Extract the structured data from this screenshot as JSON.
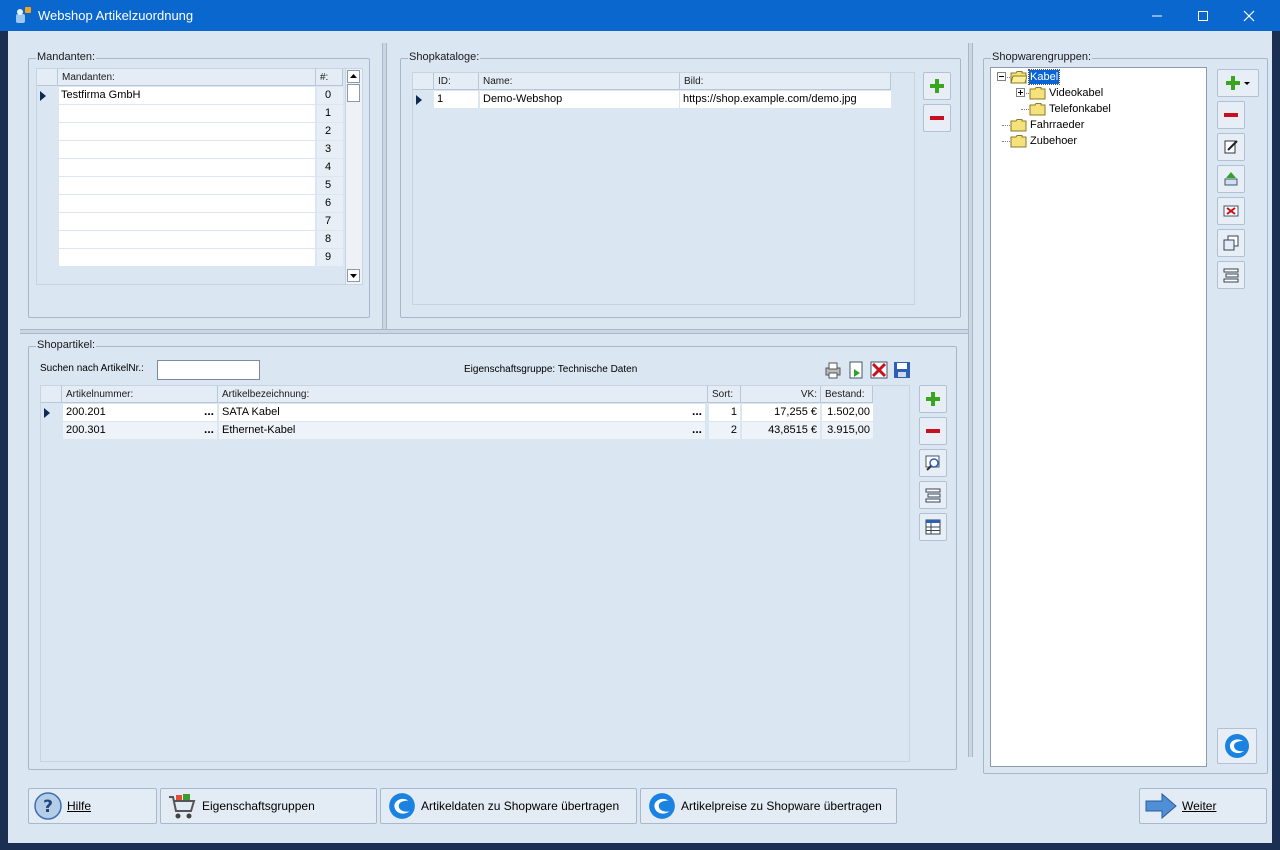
{
  "window": {
    "title": "Webshop Artikelzuordnung"
  },
  "mandanten": {
    "group_title": "Mandanten:",
    "col_name": "Mandanten:",
    "col_num": "#:",
    "rows": [
      {
        "name": "Testfirma GmbH",
        "num": "0"
      },
      {
        "name": "",
        "num": "1"
      },
      {
        "name": "",
        "num": "2"
      },
      {
        "name": "",
        "num": "3"
      },
      {
        "name": "",
        "num": "4"
      },
      {
        "name": "",
        "num": "5"
      },
      {
        "name": "",
        "num": "6"
      },
      {
        "name": "",
        "num": "7"
      },
      {
        "name": "",
        "num": "8"
      },
      {
        "name": "",
        "num": "9"
      }
    ]
  },
  "shopkataloge": {
    "group_title": "Shopkataloge:",
    "col_id": "ID:",
    "col_name": "Name:",
    "col_bild": "Bild:",
    "rows": [
      {
        "id": "1",
        "name": "Demo-Webshop",
        "bild": "https://shop.example.com/demo.jpg"
      }
    ]
  },
  "shopwarengruppen": {
    "group_title": "Shopwarengruppen:",
    "tree": [
      {
        "label": "Kabel",
        "level": 0,
        "expander": "minus",
        "open": true,
        "selected": true
      },
      {
        "label": "Videokabel",
        "level": 1,
        "expander": "plus",
        "open": false,
        "selected": false
      },
      {
        "label": "Telefonkabel",
        "level": 1,
        "expander": "none",
        "open": false,
        "selected": false
      },
      {
        "label": "Fahrraeder",
        "level": 0,
        "expander": "none",
        "open": false,
        "selected": false
      },
      {
        "label": "Zubehoer",
        "level": 0,
        "expander": "none",
        "open": false,
        "selected": false
      }
    ]
  },
  "shopartikel": {
    "group_title": "Shopartikel:",
    "search_label": "Suchen nach ArtikelNr.:",
    "search_value": "",
    "eigenschaftsgruppe": "Eigenschaftsgruppe: Technische Daten",
    "col_artnr": "Artikelnummer:",
    "col_bez": "Artikelbezeichnung:",
    "col_sort": "Sort:",
    "col_vk": "VK:",
    "col_bestand": "Bestand:",
    "rows": [
      {
        "artnr": "200.201",
        "bez": "SATA Kabel",
        "sort": "1",
        "vk": "17,255 €",
        "bestand": "1.502,00"
      },
      {
        "artnr": "200.301",
        "bez": "Ethernet-Kabel",
        "sort": "2",
        "vk": "43,8515 €",
        "bestand": "3.915,00"
      }
    ],
    "ellipsis": "..."
  },
  "buttons": {
    "hilfe": "Hilfe",
    "eigenschaftsgruppen": "Eigenschaftsgruppen",
    "artikeldaten": "Artikeldaten zu Shopware übertragen",
    "artikelpreise": "Artikelpreise zu Shopware übertragen",
    "weiter": "Weiter"
  },
  "colors": {
    "titlebar": "#0a67cd",
    "client": "#dbe6f3",
    "add_green": "#3aa61f",
    "remove_red": "#c8101e",
    "shopware_blue": "#1a82e0"
  }
}
